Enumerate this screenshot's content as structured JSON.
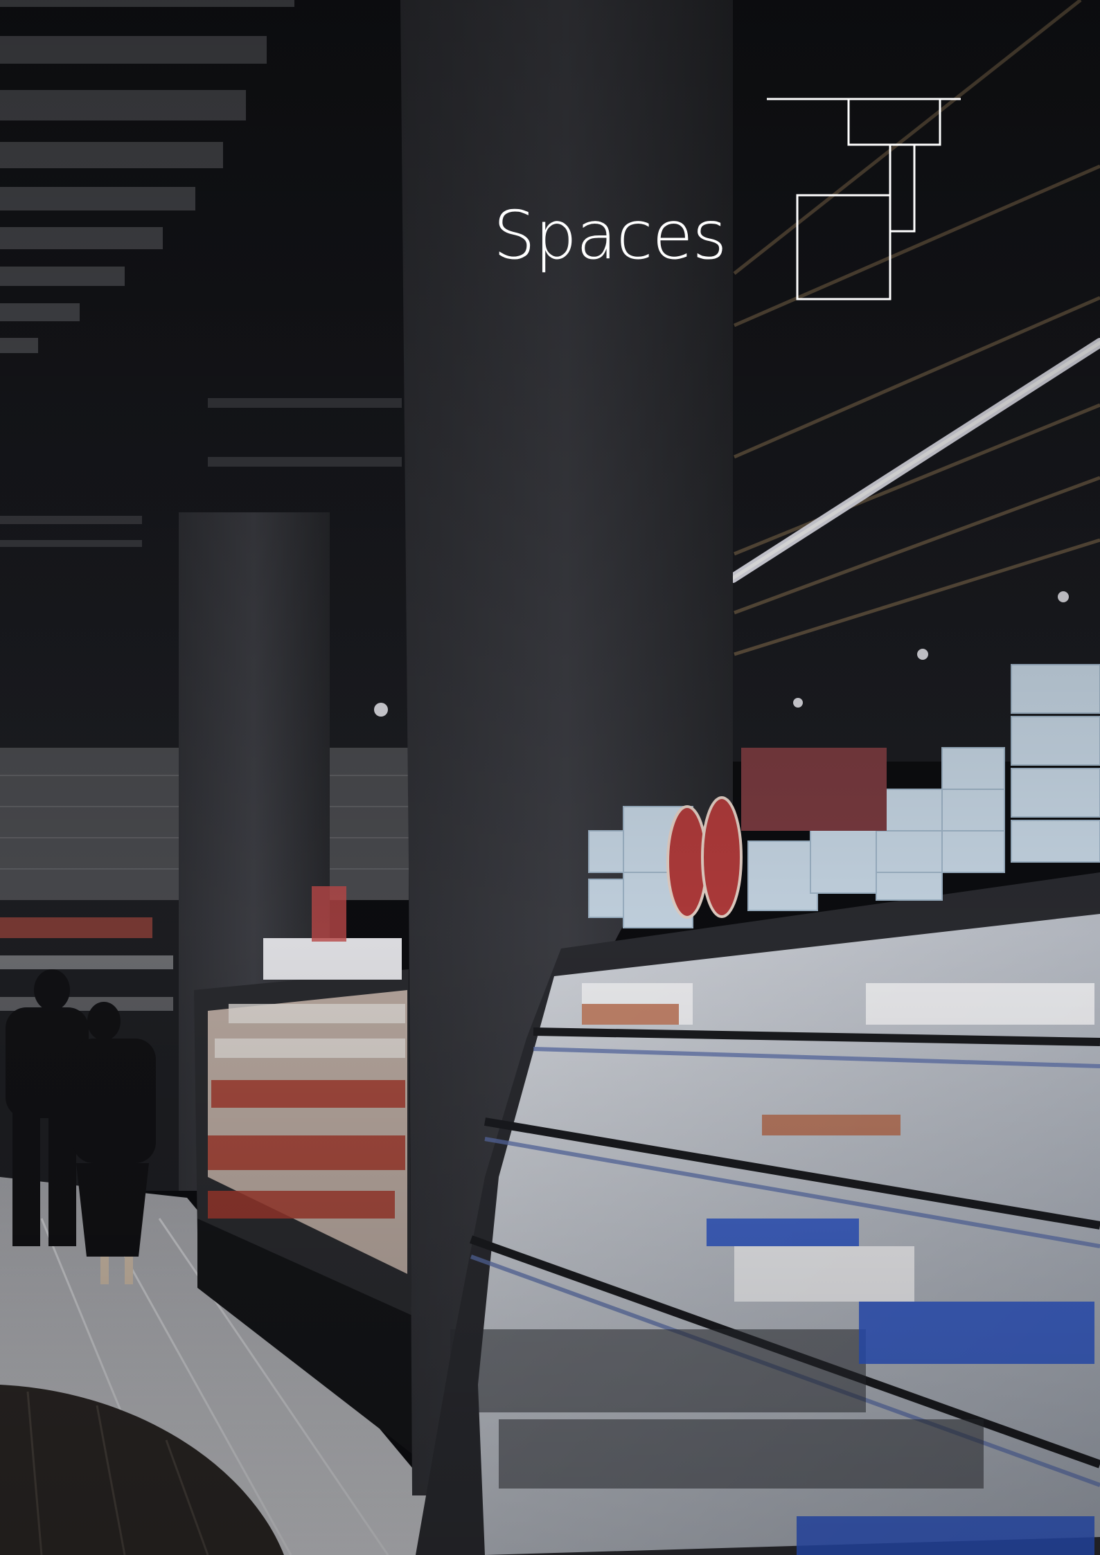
{
  "title": "Spaces",
  "background_image": "supermarket-aisle-with-refrigerated-shelves",
  "logo_icon": "interlocking-squares-outline-icon",
  "colors": {
    "title": "#ffffff",
    "logo_stroke": "#ffffff",
    "overlay": "#0b0c10"
  }
}
